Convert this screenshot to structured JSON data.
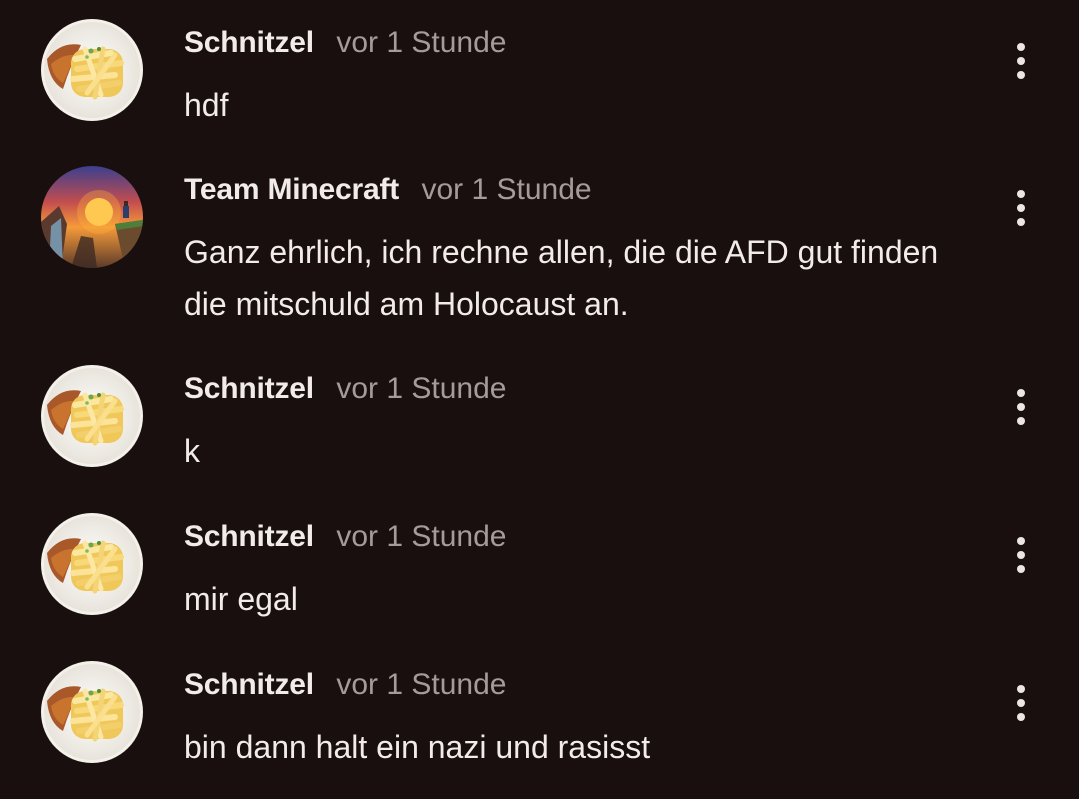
{
  "comments": [
    {
      "author": "Schnitzel",
      "time": "vor 1 Stunde",
      "text": "hdf",
      "avatar_icon": "schnitzel-fries-avatar"
    },
    {
      "author": "Team Minecraft",
      "time": "vor 1 Stunde",
      "text": "Ganz ehrlich, ich rechne allen, die die AFD gut finden die mitschuld am Holocaust an.",
      "avatar_icon": "sunset-cliff-avatar"
    },
    {
      "author": "Schnitzel",
      "time": "vor 1 Stunde",
      "text": "k",
      "avatar_icon": "schnitzel-fries-avatar"
    },
    {
      "author": "Schnitzel",
      "time": "vor 1 Stunde",
      "text": "mir egal",
      "avatar_icon": "schnitzel-fries-avatar"
    },
    {
      "author": "Schnitzel",
      "time": "vor 1 Stunde",
      "text": "bin dann halt ein nazi und rasisst",
      "avatar_icon": "schnitzel-fries-avatar"
    }
  ],
  "colors": {
    "background": "#190f0f",
    "text": "#f1ece9",
    "muted": "#a59b98"
  },
  "icons": {
    "more": "more-vertical-icon"
  }
}
